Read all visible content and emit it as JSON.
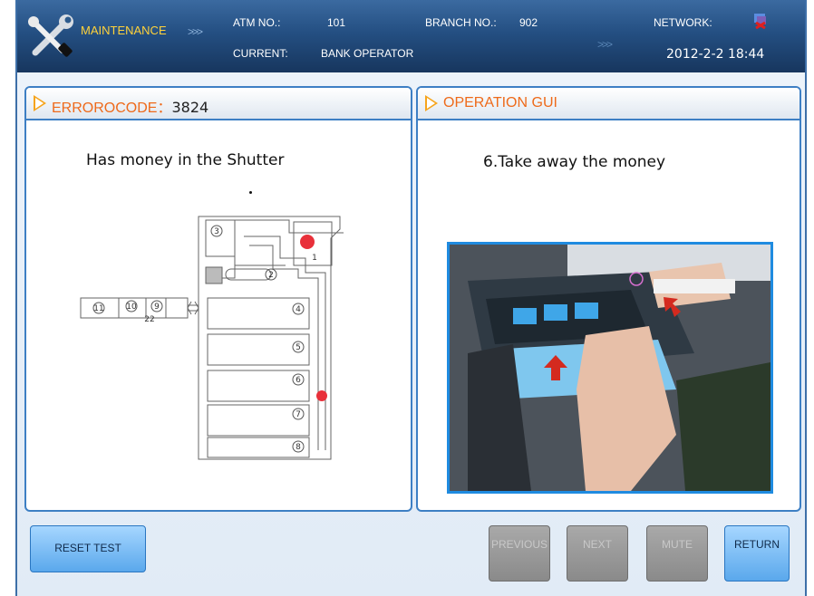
{
  "header": {
    "mode": "MAINTENANCE",
    "atm_label": "ATM NO.:",
    "atm_value": "101",
    "branch_label": "BRANCH NO.:",
    "branch_value": "902",
    "network_label": "NETWORK:",
    "current_label": "CURRENT:",
    "current_value": "BANK OPERATOR",
    "datetime": "2012-2-2  18:44"
  },
  "error_panel": {
    "title": "ERROROCODE：",
    "code": "3824",
    "message": "Has money in the Shutter",
    "diagram_labels": [
      "3",
      "1",
      "2",
      "4",
      "5",
      "6",
      "7",
      "8",
      "9",
      "10",
      "11",
      "22"
    ]
  },
  "operation_panel": {
    "title": "OPERATION GUI",
    "message": "6.Take away the money"
  },
  "buttons": {
    "reset": "RESET TEST",
    "previous": "PREVIOUS",
    "next": "NEXT",
    "mute": "MUTE",
    "return": "RETURN"
  },
  "colors": {
    "header_bg": "#244f82",
    "panel_border": "#3d7fc4",
    "accent_orange": "#f6a41c",
    "button_blue": "#5aa8ec",
    "button_disabled": "#8a8a8a"
  }
}
